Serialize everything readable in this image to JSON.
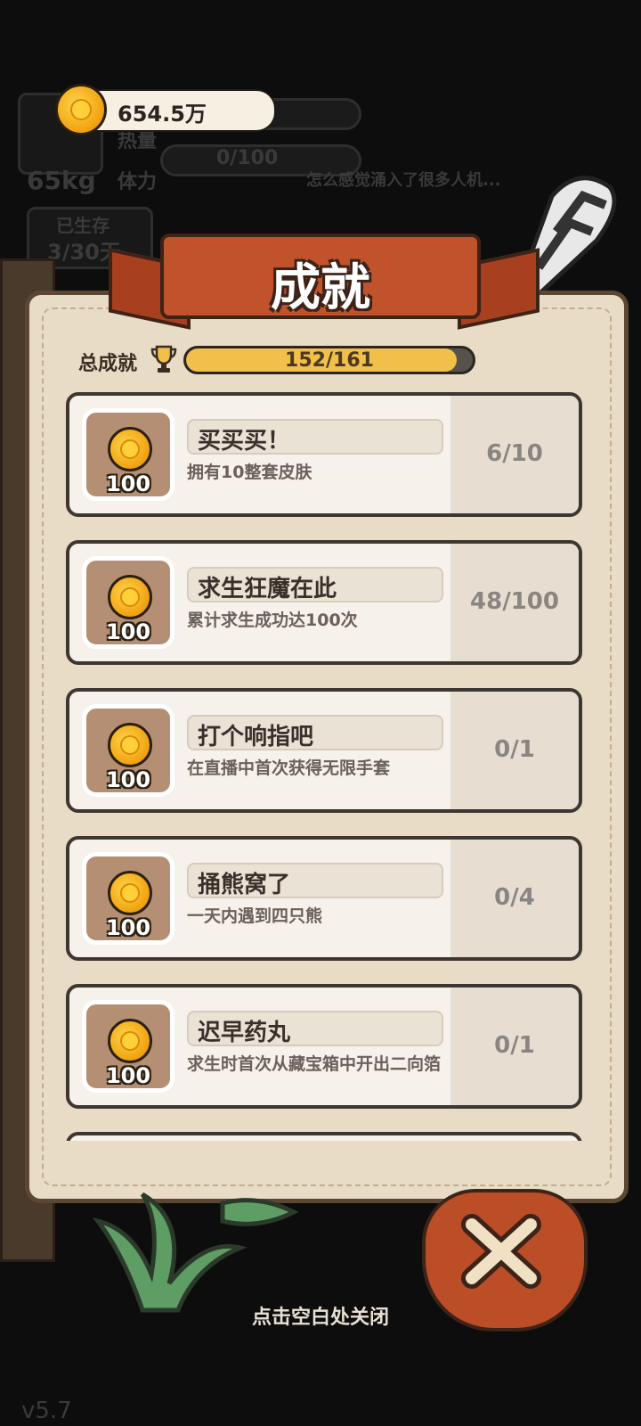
{
  "currency": {
    "amount": "654.5万"
  },
  "background": {
    "weight": "65kg",
    "heat_label": "热量",
    "stamina_label": "体力",
    "stamina_value": "0/100",
    "survived_label": "已生存",
    "survived_value": "3/30天",
    "chat": "怎么感觉涌入了很多人机..."
  },
  "dialog": {
    "title": "成就",
    "total_label": "总成就",
    "total_progress": "152/161",
    "total_fraction": 0.944,
    "close_hint": "点击空白处关闭"
  },
  "achievements": [
    {
      "title": "买买买！",
      "description": "拥有10整套皮肤",
      "progress": "6/10",
      "reward": "100"
    },
    {
      "title": "求生狂魔在此",
      "description": "累计求生成功达100次",
      "progress": "48/100",
      "reward": "100"
    },
    {
      "title": "打个响指吧",
      "description": "在直播中首次获得无限手套",
      "progress": "0/1",
      "reward": "100"
    },
    {
      "title": "捅熊窝了",
      "description": "一天内遇到四只熊",
      "progress": "0/4",
      "reward": "100"
    },
    {
      "title": "迟早药丸",
      "description": "求生时首次从藏宝箱中开出二向箔",
      "progress": "0/1",
      "reward": "100"
    }
  ],
  "version": "v5.7",
  "colors": {
    "accent": "#c0532b",
    "progress": "#f2bf49",
    "parchment": "#e8dcc6"
  }
}
